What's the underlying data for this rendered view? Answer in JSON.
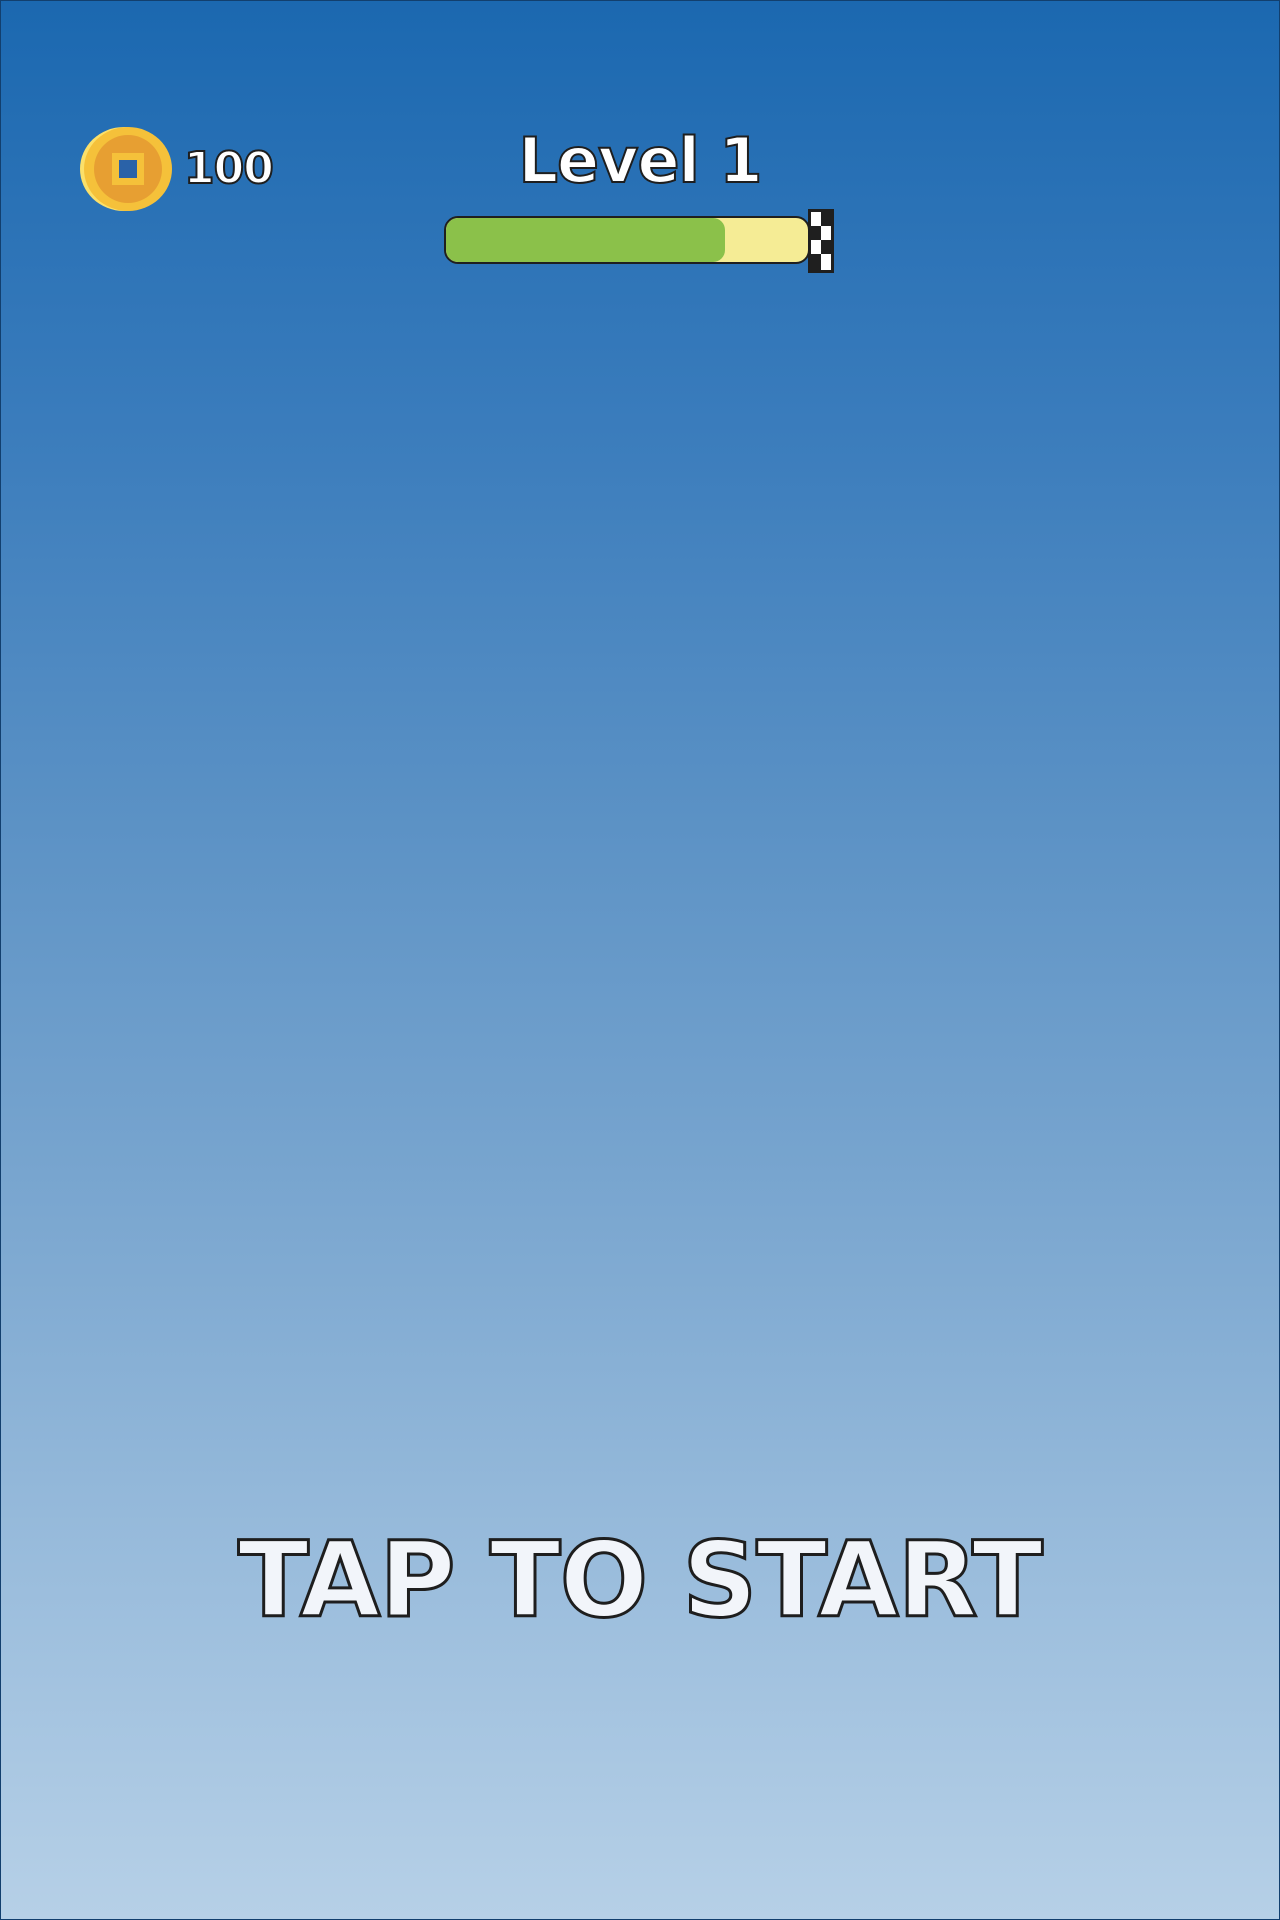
{
  "hud": {
    "coins": {
      "icon": "gold-coin-icon",
      "amount": "100"
    },
    "level": {
      "title": "Level 1",
      "progress_fraction": 0.77,
      "finish_icon": "checkered-flag-icon"
    }
  },
  "prompt": {
    "label": "TAP TO START"
  },
  "colors": {
    "sky_top": "#1b68b0",
    "sky_bottom": "#b6d0e7",
    "progress_fill": "#8bc14a",
    "progress_track": "#f5ec95",
    "coin_gold": "#f5c13a",
    "coin_inner": "#e79f32",
    "coin_hole": "#2a62a8"
  }
}
